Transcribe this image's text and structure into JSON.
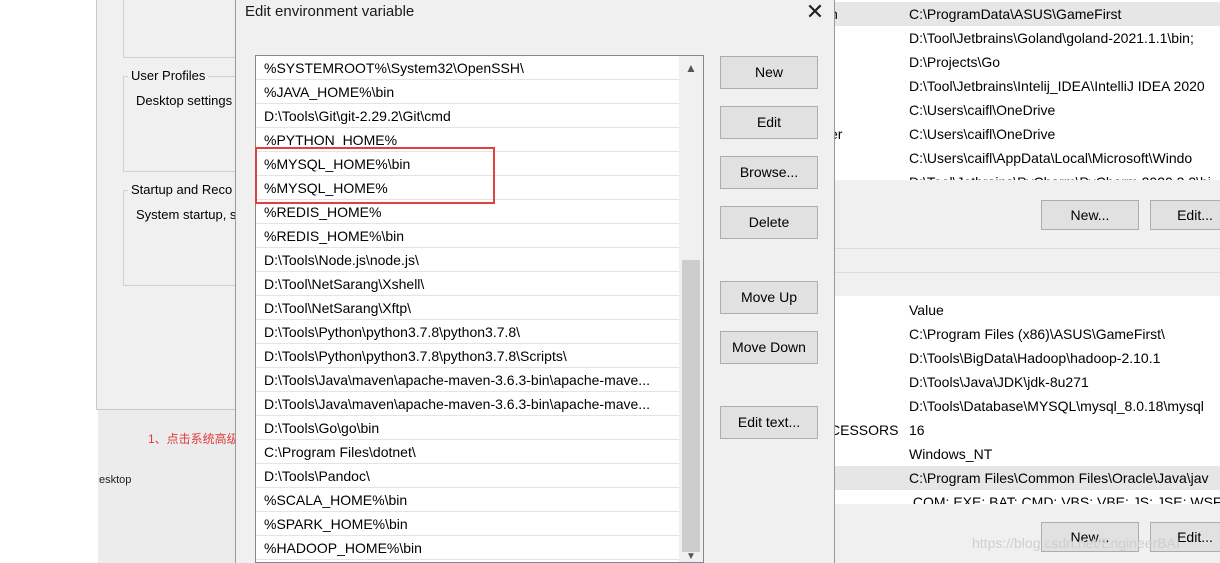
{
  "background_left": {
    "user_profiles_title": "User Profiles",
    "user_profiles_text": "Desktop settings",
    "startup_title": "Startup and Reco",
    "startup_text": "System startup, s",
    "annotation": "1、点击系统高级",
    "desktop_label": "esktop"
  },
  "background_right": {
    "top_label_fragment": "n",
    "top_label_fragment2": "er",
    "user_vars": [
      "C:\\ProgramData\\ASUS\\GameFirst",
      "D:\\Tool\\Jetbrains\\Goland\\goland-2021.1.1\\bin;",
      "D:\\Projects\\Go",
      "D:\\Tool\\Jetbrains\\Intelij_IDEA\\IntelliJ IDEA 2020",
      "C:\\Users\\caifl\\OneDrive",
      "C:\\Users\\caifl\\OneDrive",
      "C:\\Users\\caifl\\AppData\\Local\\Microsoft\\Windo",
      "D:\\Tool\\Jetbrains\\PyCharm\\PyCharm 2020.3.3\\bi"
    ],
    "buttons_top": [
      "New...",
      "Edit..."
    ],
    "value_header": "Value",
    "system_vars": [
      {
        "name": "",
        "value": "C:\\Program Files (x86)\\ASUS\\GameFirst\\"
      },
      {
        "name": "",
        "value": "D:\\Tools\\BigData\\Hadoop\\hadoop-2.10.1"
      },
      {
        "name": "",
        "value": "D:\\Tools\\Java\\JDK\\jdk-8u271"
      },
      {
        "name": "",
        "value": "D:\\Tools\\Database\\MYSQL\\mysql_8.0.18\\mysql"
      },
      {
        "name": "CESSORS",
        "value": "16"
      },
      {
        "name": "",
        "value": "Windows_NT"
      },
      {
        "name": "",
        "value": "C:\\Program Files\\Common Files\\Oracle\\Java\\jav"
      },
      {
        "name": "",
        "value": ".COM;.EXE;.BAT;.CMD;.VBS;.VBE;.JS;.JSE;.WSF;.WS"
      }
    ],
    "buttons_bottom": [
      "New...",
      "Edit..."
    ]
  },
  "dialog": {
    "title": "Edit environment variable",
    "close_glyph": "✕",
    "entries": [
      "%SYSTEMROOT%\\System32\\OpenSSH\\",
      "%JAVA_HOME%\\bin",
      "D:\\Tools\\Git\\git-2.29.2\\Git\\cmd",
      "%PYTHON_HOME%",
      "%MYSQL_HOME%\\bin",
      "%MYSQL_HOME%",
      "%REDIS_HOME%",
      "%REDIS_HOME%\\bin",
      "D:\\Tools\\Node.js\\node.js\\",
      "D:\\Tool\\NetSarang\\Xshell\\",
      "D:\\Tool\\NetSarang\\Xftp\\",
      "D:\\Tools\\Python\\python3.7.8\\python3.7.8\\",
      "D:\\Tools\\Python\\python3.7.8\\python3.7.8\\Scripts\\",
      "D:\\Tools\\Java\\maven\\apache-maven-3.6.3-bin\\apache-mave...",
      "D:\\Tools\\Java\\maven\\apache-maven-3.6.3-bin\\apache-mave...",
      "D:\\Tools\\Go\\go\\bin",
      "C:\\Program Files\\dotnet\\",
      "D:\\Tools\\Pandoc\\",
      "%SCALA_HOME%\\bin",
      "%SPARK_HOME%\\bin",
      "%HADOOP_HOME%\\bin"
    ],
    "buttons": {
      "new": "New",
      "edit": "Edit",
      "browse": "Browse...",
      "delete": "Delete",
      "move_up": "Move Up",
      "move_down": "Move Down",
      "edit_text": "Edit text..."
    },
    "scroll_up_glyph": "▲",
    "scroll_down_glyph": "▼"
  },
  "watermark": "https://blog.csdn.net/EngineerBAI",
  "colors": {
    "highlight_box": "#e04040",
    "annotation": "#e03a3a"
  }
}
